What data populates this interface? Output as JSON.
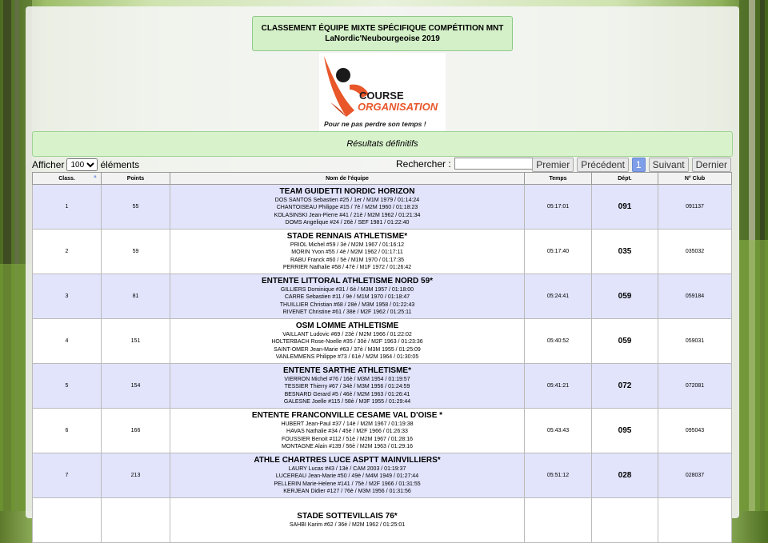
{
  "header": {
    "title_line1": "CLASSEMENT ÉQUIPE MIXTE SPÉCIFIQUE COMPÉTITION MNT",
    "title_line2": "LaNordic'Neubourgeoise 2019"
  },
  "logo": {
    "line1": "COURSE",
    "line2": "ORGANISATION",
    "slogan": "Pour ne pas perdre son temps !",
    "colors": {
      "orange": "#e8562a",
      "blue": "#2b4c8c",
      "dark": "#1a1a1a"
    }
  },
  "status": {
    "text": "Résultats définitifs"
  },
  "controls": {
    "show_label": "Afficher",
    "length_value": "100",
    "elements_label": "éléments",
    "search_label": "Rechercher :",
    "search_value": "",
    "pagination": {
      "first": "Premier",
      "previous": "Précédent",
      "current": "1",
      "next": "Suivant",
      "last": "Dernier"
    }
  },
  "table": {
    "columns": [
      "Class.",
      "Points",
      "Nom de l'équipe",
      "Temps",
      "Dépt.",
      "N° Club"
    ],
    "rows": [
      {
        "rank": "1",
        "points": "55",
        "team": "TEAM GUIDETTI NORDIC HORIZON",
        "members": [
          "DOS SANTOS Sebastien #25 / 1er / M1M 1979 / 01:14:24",
          "CHANTOISEAU Philippe #15 / 7è / M2M 1960 / 01:18:23",
          "KOLASINSKI Jean-Pierre #41 / 21è / M2M 1962 / 01:21:34",
          "DOMS Angelique #24 / 26è / SEF 1981 / 01:22:40"
        ],
        "time": "05:17:01",
        "dept": "091",
        "club": "091137"
      },
      {
        "rank": "2",
        "points": "59",
        "team": "STADE RENNAIS ATHLETISME*",
        "members": [
          "PRIOL Michel #59 / 3è / M2M 1967 / 01:16:12",
          "MORIN Yvon #55 / 4è / M2M 1962 / 01:17:11",
          "RABU Franck #60 / 5è / M1M 1970 / 01:17:35",
          "PERRIER Nathalie #58 / 47è / M1F 1972 / 01:26:42"
        ],
        "time": "05:17:40",
        "dept": "035",
        "club": "035032"
      },
      {
        "rank": "3",
        "points": "81",
        "team": "ENTENTE LITTORAL ATHLETISME NORD 59*",
        "members": [
          "GILLIERS Dominique #31 / 6è / M3M 1957 / 01:18:00",
          "CARRE Sebastien #11 / 9è / M1M 1970 / 01:18:47",
          "THUILLIER Christian #68 / 28è / M3M 1958 / 01:22:43",
          "RIVENET Christine #61 / 38è / M2F 1962 / 01:25:11"
        ],
        "time": "05:24:41",
        "dept": "059",
        "club": "059184"
      },
      {
        "rank": "4",
        "points": "151",
        "team": "OSM LOMME ATHLETISME",
        "members": [
          "VAILLANT Ludovic #69 / 23è / M2M 1966 / 01:22:02",
          "HOLTERBACH Rose-Noelle #35 / 30è / M2F 1963 / 01:23:36",
          "SAINT-OMER Jean-Marie #63 / 37è / M3M 1955 / 01:25:09",
          "VANLEMMENS Philippe #73 / 61è / M2M 1964 / 01:30:05"
        ],
        "time": "05:40:52",
        "dept": "059",
        "club": "059031"
      },
      {
        "rank": "5",
        "points": "154",
        "team": "ENTENTE SARTHE ATHLETISME*",
        "members": [
          "VIERRON Michel #76 / 16è / M3M 1954 / 01:19:57",
          "TESSIER Thierry #67 / 34è / M3M 1956 / 01:24:59",
          "BESNARD Gerard #5 / 46è / M2M 1963 / 01:26:41",
          "GALESNE Joelle #115 / 58è / M3F 1955 / 01:29:44"
        ],
        "time": "05:41:21",
        "dept": "072",
        "club": "072081"
      },
      {
        "rank": "6",
        "points": "166",
        "team": "ENTENTE FRANCONVILLE CESAME VAL D'OISE *",
        "members": [
          "HUBERT Jean-Paul #37 / 14è / M2M 1967 / 01:19:38",
          "HAVAS Nathalie #34 / 45è / M2F 1966 / 01:26:33",
          "FOUSSIER Benoit #112 / 51è / M2M 1967 / 01:28:16",
          "MONTAGNE Alain #139 / 56è / M2M 1963 / 01:29:16"
        ],
        "time": "05:43:43",
        "dept": "095",
        "club": "095043"
      },
      {
        "rank": "7",
        "points": "213",
        "team": "ATHLE CHARTRES LUCE ASPTT MAINVILLIERS*",
        "members": [
          "LAURY Lucas #43 / 13è / CAM 2003 / 01:19:37",
          "LUCEREAU Jean-Marie #50 / 49è / M4M 1949 / 01:27:44",
          "PELLERIN Marie-Helene #141 / 75è / M2F 1966 / 01:31:55",
          "KERJEAN Didier #127 / 76è / M3M 1956 / 01:31:56"
        ],
        "time": "05:51:12",
        "dept": "028",
        "club": "028037"
      },
      {
        "rank": "",
        "points": "",
        "team": "STADE SOTTEVILLAIS 76*",
        "members": [
          "SAHBI Karim #62 / 36è / M2M 1962 / 01:25:01"
        ],
        "time": "",
        "dept": "",
        "club": ""
      }
    ]
  }
}
